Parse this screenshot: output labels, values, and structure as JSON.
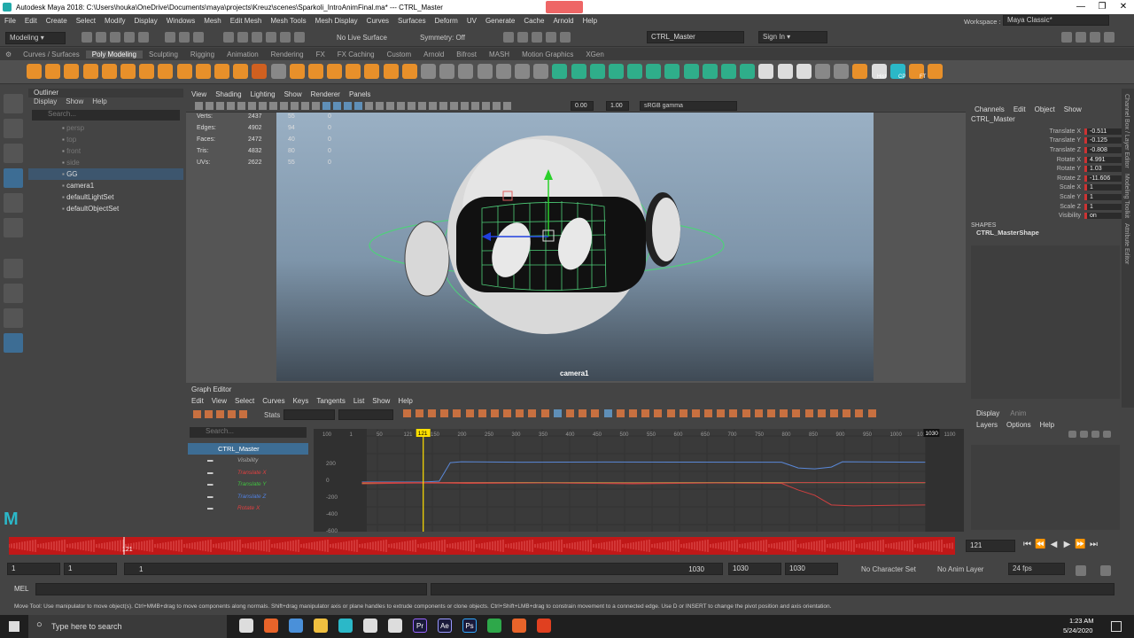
{
  "title_bar": {
    "title": "Autodesk Maya 2018: C:\\Users\\houka\\OneDrive\\Documents\\maya\\projects\\Kreuz\\scenes\\Sparkoli_IntroAnimFinal.ma*  ---  CTRL_Master",
    "minimize": "—",
    "maximize": "❐",
    "close": "✕"
  },
  "menubar": [
    "File",
    "Edit",
    "Create",
    "Select",
    "Modify",
    "Display",
    "Windows",
    "Mesh",
    "Edit Mesh",
    "Mesh Tools",
    "Mesh Display",
    "Curves",
    "Surfaces",
    "Deform",
    "UV",
    "Generate",
    "Cache",
    "Arnold",
    "Help"
  ],
  "statusline": {
    "mode": "Modeling",
    "live_surface": "No Live Surface",
    "symmetry": "Symmetry: Off",
    "object_field": "CTRL_Master",
    "sign_in": "Sign In",
    "workspace_label": "Workspace :",
    "workspace_value": "Maya Classic*"
  },
  "shelf_tabs": [
    "Curves / Surfaces",
    "Poly Modeling",
    "Sculpting",
    "Rigging",
    "Animation",
    "Rendering",
    "FX",
    "FX Caching",
    "Custom",
    "Arnold",
    "Bifrost",
    "MASH",
    "Motion Graphics",
    "XGen"
  ],
  "shelf_active": "Poly Modeling",
  "shelf_labels": [
    "Hist",
    "CP",
    "FT"
  ],
  "outliner": {
    "title": "Outliner",
    "menu": [
      "Display",
      "Show",
      "Help"
    ],
    "search_placeholder": "Search...",
    "items": [
      {
        "label": "persp",
        "dim": true
      },
      {
        "label": "top",
        "dim": true
      },
      {
        "label": "front",
        "dim": true
      },
      {
        "label": "side",
        "dim": true
      },
      {
        "label": "GG",
        "dim": false,
        "selected": true
      },
      {
        "label": "camera1",
        "dim": false
      },
      {
        "label": "defaultLightSet",
        "dim": false
      },
      {
        "label": "defaultObjectSet",
        "dim": false
      }
    ]
  },
  "viewport": {
    "menu": [
      "View",
      "Shading",
      "Lighting",
      "Show",
      "Renderer",
      "Panels"
    ],
    "exposure": "0.00",
    "gamma": "1.00",
    "color_space": "sRGB gamma",
    "camera_label": "camera1",
    "stats": [
      {
        "k": "Verts:",
        "a": "2437",
        "b": "55",
        "c": "0"
      },
      {
        "k": "Edges:",
        "a": "4902",
        "b": "94",
        "c": "0"
      },
      {
        "k": "Faces:",
        "a": "2472",
        "b": "40",
        "c": "0"
      },
      {
        "k": "Tris:",
        "a": "4832",
        "b": "80",
        "c": "0"
      },
      {
        "k": "UVs:",
        "a": "2622",
        "b": "55",
        "c": "0"
      }
    ]
  },
  "channel_box": {
    "menu": [
      "Channels",
      "Edit",
      "Object",
      "Show"
    ],
    "object": "CTRL_Master",
    "attrs": [
      {
        "k": "Translate X",
        "v": "-0.511"
      },
      {
        "k": "Translate Y",
        "v": "-0.125"
      },
      {
        "k": "Translate Z",
        "v": "-0.808"
      },
      {
        "k": "Rotate X",
        "v": "4.991"
      },
      {
        "k": "Rotate Y",
        "v": "1.03"
      },
      {
        "k": "Rotate Z",
        "v": "-11.606"
      },
      {
        "k": "Scale X",
        "v": "1"
      },
      {
        "k": "Scale Y",
        "v": "1"
      },
      {
        "k": "Scale Z",
        "v": "1"
      },
      {
        "k": "Visibility",
        "v": "on"
      }
    ],
    "shapes_label": "SHAPES",
    "shape_name": "CTRL_MasterShape",
    "side_tabs": [
      "Channel Box / Layer Editor",
      "Modeling Toolkit",
      "Attribute Editor"
    ]
  },
  "layer_editor": {
    "tabs": [
      "Display",
      "Anim"
    ],
    "menu": [
      "Layers",
      "Options",
      "Help"
    ]
  },
  "graph_editor": {
    "title": "Graph Editor",
    "menu": [
      "Edit",
      "View",
      "Select",
      "Curves",
      "Keys",
      "Tangents",
      "List",
      "Show",
      "Help"
    ],
    "stats_label": "Stats",
    "search_placeholder": "Search...",
    "object": "CTRL_Master",
    "channels": [
      {
        "label": "Visibility",
        "color": "#aaaaaa"
      },
      {
        "label": "Translate X",
        "color": "#e04040"
      },
      {
        "label": "Translate Y",
        "color": "#40c040"
      },
      {
        "label": "Translate Z",
        "color": "#5080e0"
      },
      {
        "label": "Rotate X",
        "color": "#e04040"
      }
    ],
    "frame_ticks": [
      "100",
      "1",
      "50",
      "121",
      "150",
      "200",
      "250",
      "300",
      "350",
      "400",
      "450",
      "500",
      "550",
      "600",
      "650",
      "700",
      "750",
      "800",
      "850",
      "900",
      "950",
      "1000",
      "1030",
      "1100"
    ],
    "value_ticks": [
      "200",
      "0",
      "-200",
      "-400",
      "-600"
    ],
    "current_frame_marker": "121",
    "end_marker": "1030"
  },
  "chart_data": {
    "type": "line",
    "x_range": [
      100,
      1100
    ],
    "y_range": [
      -650,
      400
    ],
    "series": [
      {
        "name": "Translate Z",
        "color": "#5a88d8",
        "points": [
          [
            10,
            0
          ],
          [
            121,
            0
          ],
          [
            150,
            10
          ],
          [
            170,
            220
          ],
          [
            190,
            230
          ],
          [
            300,
            225
          ],
          [
            450,
            228
          ],
          [
            600,
            226
          ],
          [
            770,
            225
          ],
          [
            800,
            160
          ],
          [
            830,
            150
          ],
          [
            860,
            170
          ],
          [
            880,
            230
          ],
          [
            950,
            228
          ],
          [
            1030,
            225
          ]
        ]
      },
      {
        "name": "Translate Y",
        "color": "#b0b040",
        "points": [
          [
            10,
            -10
          ],
          [
            121,
            -5
          ],
          [
            300,
            -5
          ],
          [
            500,
            -8
          ],
          [
            700,
            -5
          ],
          [
            1030,
            -8
          ]
        ]
      },
      {
        "name": "Translate X",
        "color": "#d04040",
        "points": [
          [
            10,
            -20
          ],
          [
            60,
            -15
          ],
          [
            121,
            -10
          ],
          [
            200,
            -15
          ],
          [
            350,
            -10
          ],
          [
            500,
            -20
          ],
          [
            650,
            -10
          ],
          [
            770,
            -15
          ],
          [
            800,
            -90
          ],
          [
            830,
            -150
          ],
          [
            860,
            -260
          ],
          [
            900,
            -270
          ],
          [
            1030,
            -260
          ]
        ]
      },
      {
        "name": "Rotate X",
        "color": "#c04848",
        "points": [
          [
            10,
            -5
          ],
          [
            121,
            -5
          ],
          [
            400,
            -12
          ],
          [
            770,
            -10
          ],
          [
            800,
            -5
          ],
          [
            1030,
            -5
          ]
        ]
      }
    ],
    "current_frame": 121
  },
  "time_slider": {
    "current": "121",
    "field": "121",
    "playback": [
      "⏮",
      "⏪",
      "◀",
      "▶",
      "⏩",
      "⏭"
    ]
  },
  "range_slider": {
    "start": "1",
    "anim_start": "1",
    "range_label": "1",
    "range_end_label": "1030",
    "end": "1030",
    "anim_end": "1030",
    "character_set": "No Character Set",
    "anim_layer": "No Anim Layer",
    "fps": "24 fps"
  },
  "mel": {
    "label": "MEL"
  },
  "help_line": "Move Tool: Use manipulator to move object(s). Ctrl+MMB+drag to move components along normals. Shift+drag manipulator axis or plane handles to extrude components or clone objects. Ctrl+Shift+LMB+drag to constrain movement to a connected edge. Use D or INSERT to change the pivot position and axis orientation.",
  "taskbar": {
    "search_placeholder": "Type here to search",
    "time": "1:23 AM",
    "date": "5/24/2020",
    "app_labels": [
      "Pr",
      "Ae",
      "Ps"
    ]
  }
}
